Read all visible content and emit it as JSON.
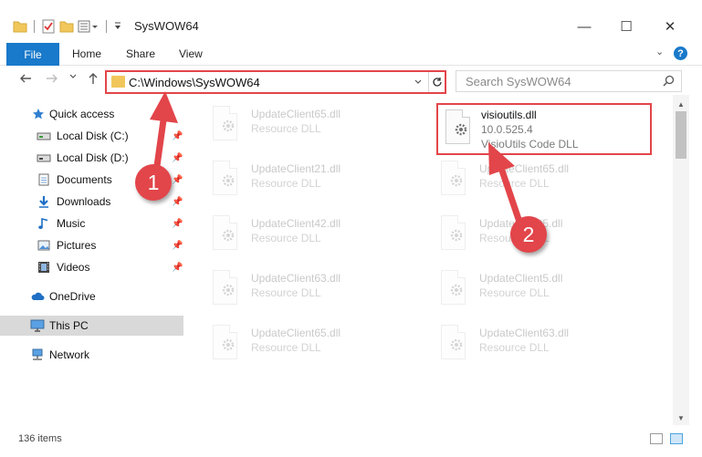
{
  "window": {
    "title": "SysWOW64",
    "minimize_glyph": "—",
    "maximize_glyph": "☐",
    "close_glyph": "✕"
  },
  "ribbon": {
    "tabs": [
      {
        "label": "File"
      },
      {
        "label": "Home"
      },
      {
        "label": "Share"
      },
      {
        "label": "View"
      }
    ],
    "help_glyph": "?"
  },
  "address_bar": {
    "path": "C:\\Windows\\SysWOW64",
    "search_placeholder": "Search SysWOW64"
  },
  "sidebar": {
    "items": [
      {
        "label": "Quick access",
        "icon": "star-icon"
      },
      {
        "label": "Local Disk (C:)",
        "icon": "drive-icon",
        "pinned": true
      },
      {
        "label": "Local Disk (D:)",
        "icon": "drive-icon",
        "pinned": true
      },
      {
        "label": "Documents",
        "icon": "documents-icon",
        "pinned": true
      },
      {
        "label": "Downloads",
        "icon": "download-icon",
        "pinned": true
      },
      {
        "label": "Music",
        "icon": "music-icon",
        "pinned": true
      },
      {
        "label": "Pictures",
        "icon": "pictures-icon",
        "pinned": true
      },
      {
        "label": "Videos",
        "icon": "videos-icon",
        "pinned": true
      },
      {
        "label": "OneDrive",
        "icon": "cloud-icon"
      },
      {
        "label": "This PC",
        "icon": "computer-icon",
        "selected": true
      },
      {
        "label": "Network",
        "icon": "network-icon"
      }
    ]
  },
  "files": {
    "left_column": [
      {
        "name": "UpdateClient65.dll",
        "type": "Resource DLL"
      },
      {
        "name": "UpdateClient21.dll",
        "type": "Resource DLL"
      },
      {
        "name": "UpdateClient42.dll",
        "type": "Resource DLL"
      },
      {
        "name": "UpdateClient63.dll",
        "type": "Resource DLL"
      },
      {
        "name": "UpdateClient65.dll",
        "type": "Resource DLL"
      }
    ],
    "right_column": [
      {
        "name": "UpdateClient65.dll",
        "type": "Resource DLL"
      },
      {
        "name": "UpdateClient5.dll",
        "type": "Resource DLL"
      },
      {
        "name": "UpdateClient5.dll",
        "type": "Resource DLL"
      },
      {
        "name": "UpdateClient63.dll",
        "type": "Resource DLL"
      }
    ],
    "highlighted": {
      "name": "visioutils.dll",
      "version": "10.0.525.4",
      "description": "VisioUtils Code DLL"
    }
  },
  "status_bar": {
    "item_count": "136 items"
  },
  "annotations": {
    "step1": "1",
    "step2": "2",
    "accent_color": "#e2454a"
  }
}
